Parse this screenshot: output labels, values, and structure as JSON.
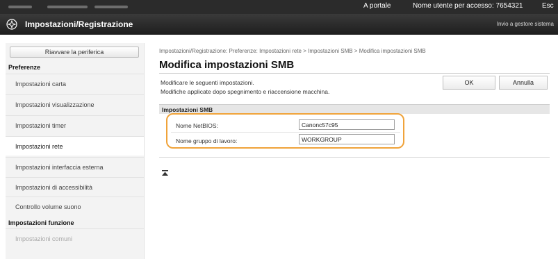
{
  "topbar": {
    "portal_label": "A portale",
    "user_text": "Nome utente per accesso:  7654321",
    "logout_label": "Esc"
  },
  "header": {
    "app_title": "Impostazioni/Registrazione",
    "send_admin_label": "Invio a gestore sistema"
  },
  "sidebar": {
    "restart_label": "Riavvare la periferica",
    "section_preferences": "Preferenze",
    "items": [
      {
        "label": "Impostazioni carta"
      },
      {
        "label": "Impostazioni visualizzazione"
      },
      {
        "label": "Impostazioni timer"
      },
      {
        "label": "Impostazioni rete"
      },
      {
        "label": "Impostazioni interfaccia esterna"
      },
      {
        "label": "Impostazioni di accessibilità"
      },
      {
        "label": "Controllo volume suono"
      }
    ],
    "section_functions": "Impostazioni funzione",
    "function_items": [
      {
        "label": "Impostazioni comuni"
      }
    ]
  },
  "main": {
    "breadcrumb": "Impostazioni/Registrazione: Preferenze: Impostazioni rete > Impostazioni SMB > Modifica impostazioni SMB",
    "title": "Modifica impostazioni SMB",
    "description_line1": "Modificare le seguenti impostazioni.",
    "description_line2": "Modifiche applicate dopo spegnimento e riaccensione macchina.",
    "ok_label": "OK",
    "cancel_label": "Annulla",
    "group_title": "Impostazioni SMB",
    "fields": {
      "netbios_label": "Nome NetBIOS:",
      "netbios_value": "Canonc57c95",
      "workgroup_label": "Nome gruppo di lavoro:",
      "workgroup_value": "WORKGROUP"
    }
  },
  "colors": {
    "highlight": "#f0a33a",
    "header_bg": "#2b2b2b"
  }
}
